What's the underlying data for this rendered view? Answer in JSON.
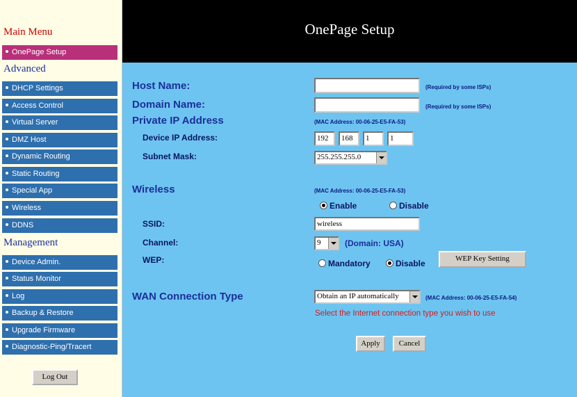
{
  "sidebar": {
    "main_menu_title": "Main Menu",
    "onepage_item": "OnePage Setup",
    "advanced_title": "Advanced",
    "advanced_items": [
      "DHCP Settings",
      "Access Control",
      "Virtual Server",
      "DMZ Host",
      "Dynamic Routing",
      "Static Routing",
      "Special App",
      "Wireless",
      "DDNS"
    ],
    "management_title": "Management",
    "management_items": [
      "Device Admin.",
      "Status Monitor",
      "Log",
      "Backup & Restore",
      "Upgrade Firmware",
      "Diagnostic-Ping/Tracert"
    ],
    "logout_label": "Log Out"
  },
  "header": {
    "title": "OnePage Setup"
  },
  "form": {
    "host_name_label": "Host Name:",
    "host_name_value": "",
    "host_name_note": "(Required by some ISPs)",
    "domain_name_label": "Domain Name:",
    "domain_name_value": "",
    "domain_name_note": "(Required by some ISPs)",
    "private_ip_label": "Private IP Address",
    "private_ip_mac": "(MAC Address: 00-06-25-E5-FA-53)",
    "device_ip_label": "Device IP Address:",
    "device_ip": [
      "192",
      "168",
      "1",
      "1"
    ],
    "subnet_label": "Subnet Mask:",
    "subnet_value": "255.255.255.0",
    "wireless_label": "Wireless",
    "wireless_mac": "(MAC Address: 00-06-25-E5-FA-53)",
    "enable_label": "Enable",
    "disable_label": "Disable",
    "ssid_label": "SSID:",
    "ssid_value": "wireless",
    "channel_label": "Channel:",
    "channel_value": "9",
    "domain_note": "(Domain: USA)",
    "wep_label": "WEP:",
    "mandatory_label": "Mandatory",
    "wep_disable_label": "Disable",
    "wep_key_button": "WEP Key Setting",
    "wan_label": "WAN Connection Type",
    "wan_value": "Obtain an IP automatically",
    "wan_mac": "(MAC Address: 00-06-25-E5-FA-54)",
    "wan_hint": "Select the Internet connection type you wish to use",
    "apply_label": "Apply",
    "cancel_label": "Cancel"
  },
  "colors": {
    "content_bg": "#6ec4f0",
    "menu_item": "#2e6fae",
    "menu_active": "#b8307a",
    "header_bg": "#000000",
    "title_red": "#cc0000",
    "hint_red": "#cc2020"
  }
}
